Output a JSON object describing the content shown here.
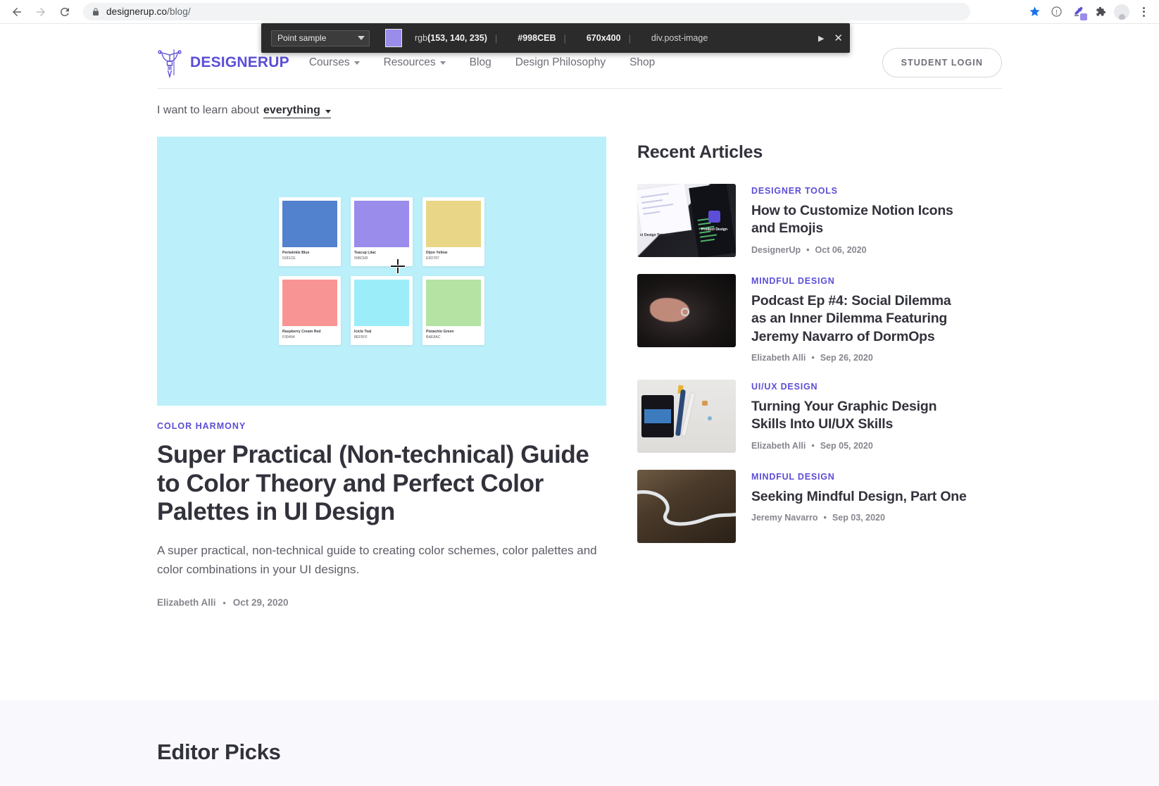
{
  "browser": {
    "back_icon": "back-arrow-icon",
    "forward_icon": "forward-arrow-icon",
    "reload_icon": "reload-icon",
    "lock_icon": "lock-icon",
    "url_domain": "designerup.co",
    "url_path": "/blog/",
    "bookmark_icon": "star-icon",
    "info_icon": "info-circle-icon",
    "eyedropper_icon": "eyedropper-icon",
    "extensions_icon": "puzzle-piece-icon",
    "profile_icon": "avatar-icon",
    "menu_icon": "kebab-menu-icon"
  },
  "eyedropper": {
    "mode": "Point sample",
    "swatch_color": "#998CEB",
    "rgb": "rgb(153, 140, 235)",
    "rgb_prefix": "rgb",
    "rgb_values": "(153, 140, 235)",
    "hex": "#998CEB",
    "dimensions": "670x400",
    "selector": "div.post-image",
    "expand_icon": "play-triangle-icon",
    "close_icon": "close-x-icon"
  },
  "site": {
    "logo_text": "DESIGNERUP",
    "logo_icon": "pen-nib-icon",
    "brand_color": "#5C4ED6",
    "nav": [
      {
        "label": "Courses",
        "has_dropdown": true
      },
      {
        "label": "Resources",
        "has_dropdown": true
      },
      {
        "label": "Blog",
        "has_dropdown": false
      },
      {
        "label": "Design Philosophy",
        "has_dropdown": false
      },
      {
        "label": "Shop",
        "has_dropdown": false
      }
    ],
    "login_label": "STUDENT LOGIN"
  },
  "filter": {
    "prefix": "I want to learn about",
    "value": "everything",
    "caret_icon": "chevron-down-icon"
  },
  "feature": {
    "image_bg": "#BBF0FA",
    "swatches": [
      {
        "name": "Periwinkle Blue",
        "hex": "5281CE",
        "color": "#5281CE"
      },
      {
        "name": "Teacup Lilac",
        "hex": "998CEB",
        "color": "#998CEB"
      },
      {
        "name": "Dijon Yellow",
        "hex": "E9D787",
        "color": "#E9D787"
      },
      {
        "name": "Raspberry Cream Red",
        "hex": "F99494",
        "color": "#F99494"
      },
      {
        "name": "Icicle Teal",
        "hex": "8EF5FF",
        "color": "#9CEDFA"
      },
      {
        "name": "Pistachio Green",
        "hex": "BAE8AC",
        "color": "#B4E3A4"
      }
    ],
    "kicker": "COLOR HARMONY",
    "title": "Super Practical (Non-technical) Guide to Color Theory and Perfect Color Palettes in UI Design",
    "excerpt": "A super practical, non-technical guide to creating color schemes, color palettes and color combinations in your UI designs.",
    "author": "Elizabeth Alli",
    "separator": "•",
    "date": "Oct 29, 2020"
  },
  "sidebar": {
    "title": "Recent Articles",
    "articles": [
      {
        "kicker": "DESIGNER TOOLS",
        "title": "How to Customize Notion Icons and Emojis",
        "author": "DesignerUp",
        "separator": "•",
        "date": "Oct 06, 2020",
        "thumb_caption": "ct Design Templates",
        "thumb_caption2": "Product Design"
      },
      {
        "kicker": "MINDFUL DESIGN",
        "title": "Podcast Ep #4: Social Dilemma as an Inner Dilemma Featuring Jeremy Navarro of DormOps",
        "author": "Elizabeth Alli",
        "separator": "•",
        "date": "Sep 26, 2020"
      },
      {
        "kicker": "UI/UX DESIGN",
        "title": "Turning Your Graphic Design Skills Into UI/UX Skills",
        "author": "Elizabeth Alli",
        "separator": "•",
        "date": "Sep 05, 2020"
      },
      {
        "kicker": "MINDFUL DESIGN",
        "title": "Seeking Mindful Design, Part One",
        "author": "Jeremy Navarro",
        "separator": "•",
        "date": "Sep 03, 2020"
      }
    ]
  },
  "picks": {
    "title": "Editor Picks"
  }
}
